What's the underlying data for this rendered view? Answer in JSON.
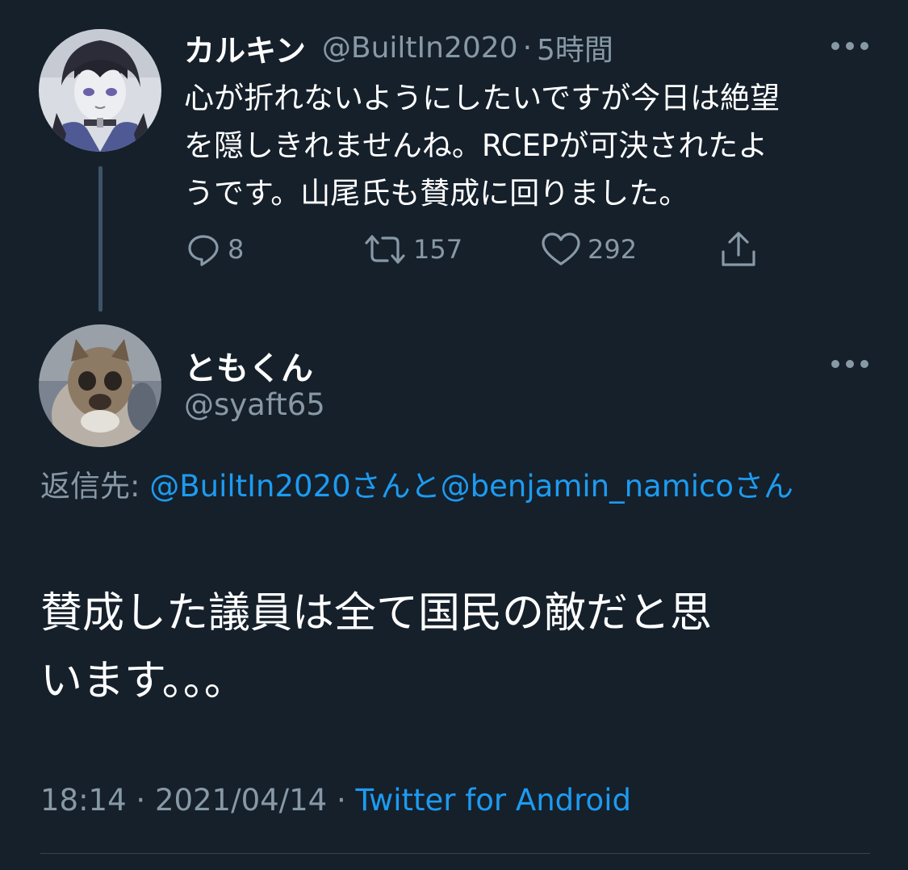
{
  "colors": {
    "background": "#15202b",
    "text_primary": "#ffffff",
    "text_secondary": "#8899a6",
    "link": "#1d9bf0",
    "thread_line": "#3d5466",
    "divider": "#38444d"
  },
  "parent_tweet": {
    "avatar_icon": "anime-character-avatar",
    "display_name": "カルキン",
    "handle": "@BuiltIn2020",
    "separator": "·",
    "time_ago": "5時間",
    "more_icon": "more-dots-icon",
    "text_lines": [
      "心が折れないようにしたいですが今日は絶望",
      "を隠しきれませんね。RCEPが可決されたよ",
      "うです。山尾氏も賛成に回りました。"
    ],
    "actions": {
      "reply": {
        "icon": "reply-icon",
        "count": "8"
      },
      "retweet": {
        "icon": "retweet-icon",
        "count": "157"
      },
      "like": {
        "icon": "heart-icon",
        "count": "292"
      },
      "share": {
        "icon": "share-icon"
      }
    }
  },
  "main_tweet": {
    "avatar_icon": "cat-photo-avatar",
    "display_name": "ともくん",
    "handle": "@syaft65",
    "more_icon": "more-dots-icon",
    "reply_to": {
      "label": "返信先:",
      "mention_1": "@BuiltIn2020",
      "joiner_1": "さんと",
      "mention_2": "@benjamin_namico",
      "suffix": "さん"
    },
    "text_lines": [
      "賛成した議員は全て国民の敵だと思",
      "います。。。"
    ],
    "timestamp_time": "18:14",
    "timestamp_date": "2021/04/14",
    "separator": "·",
    "source": "Twitter for Android"
  }
}
